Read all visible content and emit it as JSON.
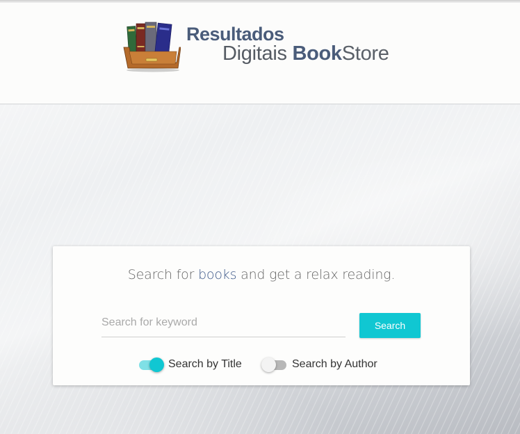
{
  "header": {
    "logo_line1": "Resultados",
    "logo_line2_a": "Digitais",
    "logo_line2_b": "Book",
    "logo_line2_c": "Store",
    "logo_icon": "bookshelf-icon"
  },
  "search": {
    "tagline_before": "Search for ",
    "tagline_highlight": "books",
    "tagline_after": " and get a relax reading.",
    "placeholder": "Search for keyword",
    "value": "",
    "button_label": "Search",
    "toggles": [
      {
        "label": "Search by Title",
        "on": true
      },
      {
        "label": "Search by Author",
        "on": false
      }
    ]
  },
  "colors": {
    "accent": "#10c7d2",
    "brand": "#4a5c7a",
    "highlight": "#3f5a8a"
  }
}
